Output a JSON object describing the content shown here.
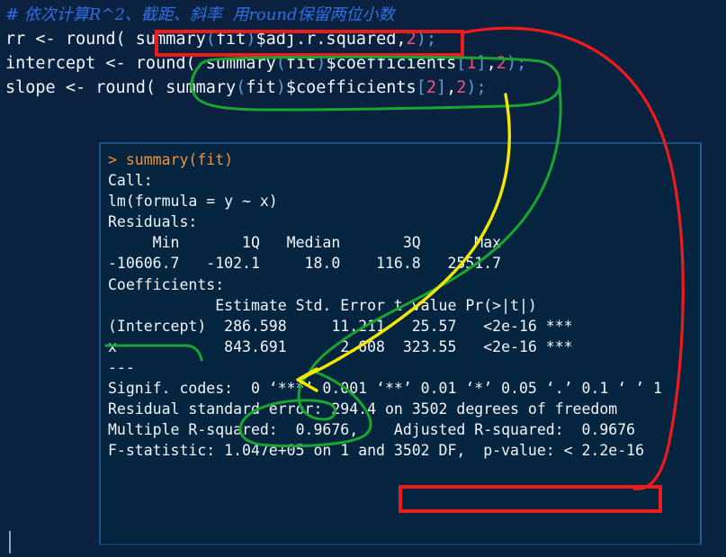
{
  "theme": {
    "editor_background": "#0a2240",
    "console_background": "#04243f",
    "console_border": "#1c4f86",
    "text": "#f2f6fa",
    "comment": "#2f6fe0",
    "prompt": "#f59331",
    "number": "#f0527f",
    "paren": "#5b9bd5",
    "annotation_red": "#ee1b1b",
    "annotation_green": "#1aa52e",
    "annotation_yellow": "#f5e800"
  },
  "editor": {
    "lines": [
      {
        "id": "comment-line",
        "tokens": [
          {
            "text": "# 依次计算R^2、截距、斜率  用round保留两位小数",
            "cls": "cmt"
          }
        ]
      },
      {
        "id": "line-rr",
        "tokens": [
          {
            "text": "rr <- round( summary",
            "cls": "ident"
          },
          {
            "text": "(",
            "cls": "paren"
          },
          {
            "text": "fit",
            "cls": "ident"
          },
          {
            "text": ")",
            "cls": "paren"
          },
          {
            "text": "$adj.r.squared",
            "cls": "ident"
          },
          {
            "text": ",",
            "cls": "punct"
          },
          {
            "text": "2",
            "cls": "num"
          },
          {
            "text": ")",
            "cls": "paren"
          },
          {
            "text": ";",
            "cls": "paren"
          }
        ]
      },
      {
        "id": "line-intercept",
        "tokens": [
          {
            "text": "intercept <- round( summary",
            "cls": "ident"
          },
          {
            "text": "(",
            "cls": "paren"
          },
          {
            "text": "fit",
            "cls": "ident"
          },
          {
            "text": ")",
            "cls": "paren"
          },
          {
            "text": "$coefficients",
            "cls": "ident"
          },
          {
            "text": "[",
            "cls": "paren"
          },
          {
            "text": "1",
            "cls": "num"
          },
          {
            "text": "]",
            "cls": "paren"
          },
          {
            "text": ",",
            "cls": "punct"
          },
          {
            "text": "2",
            "cls": "num"
          },
          {
            "text": ")",
            "cls": "paren"
          },
          {
            "text": ";",
            "cls": "paren"
          }
        ]
      },
      {
        "id": "line-slope",
        "tokens": [
          {
            "text": "slope <- round( summary",
            "cls": "ident"
          },
          {
            "text": "(",
            "cls": "paren"
          },
          {
            "text": "fit",
            "cls": "ident"
          },
          {
            "text": ")",
            "cls": "paren"
          },
          {
            "text": "$coefficients",
            "cls": "ident"
          },
          {
            "text": "[",
            "cls": "paren"
          },
          {
            "text": "2",
            "cls": "num"
          },
          {
            "text": "]",
            "cls": "paren"
          },
          {
            "text": ",",
            "cls": "punct"
          },
          {
            "text": "2",
            "cls": "num"
          },
          {
            "text": ")",
            "cls": "paren"
          },
          {
            "text": ";",
            "cls": "paren"
          }
        ]
      }
    ]
  },
  "console": {
    "lines": [
      {
        "text": "> summary(fit)",
        "kind": "prompt"
      },
      {
        "text": "",
        "kind": "blank"
      },
      {
        "text": "Call:",
        "kind": "out"
      },
      {
        "text": "lm(formula = y ~ x)",
        "kind": "out"
      },
      {
        "text": "",
        "kind": "blank"
      },
      {
        "text": "Residuals:",
        "kind": "out"
      },
      {
        "text": "     Min       1Q   Median       3Q      Max",
        "kind": "out"
      },
      {
        "text": "-10606.7   -102.1     18.0    116.8   2551.7",
        "kind": "out"
      },
      {
        "text": "",
        "kind": "blank"
      },
      {
        "text": "Coefficients:",
        "kind": "out"
      },
      {
        "text": "            Estimate Std. Error t value Pr(>|t|)",
        "kind": "out"
      },
      {
        "text": "(Intercept)  286.598     11.211   25.57   <2e-16 ***",
        "kind": "out"
      },
      {
        "text": "x            843.691      2.608  323.55   <2e-16 ***",
        "kind": "out"
      },
      {
        "text": "---",
        "kind": "out"
      },
      {
        "text": "Signif. codes:  0 ‘***’ 0.001 ‘**’ 0.01 ‘*’ 0.05 ‘.’ 0.1 ‘ ’ 1",
        "kind": "out"
      },
      {
        "text": "",
        "kind": "blank"
      },
      {
        "text": "Residual standard error: 294.4 on 3502 degrees of freedom",
        "kind": "out"
      },
      {
        "text": "Multiple R-squared:  0.9676,\tAdjusted R-squared:  0.9676",
        "kind": "out"
      },
      {
        "text": "F-statistic: 1.047e+05 on 1 and 3502 DF,  p-value: < 2.2e-16",
        "kind": "out"
      }
    ],
    "summary_values": {
      "call_formula": "lm(formula = y ~ x)",
      "residual_min": "-10606.7",
      "residual_1q": "-102.1",
      "residual_median": "18.0",
      "residual_3q": "116.8",
      "residual_max": "2551.7",
      "intercept_estimate": "286.598",
      "intercept_std_error": "11.211",
      "intercept_t_value": "25.57",
      "intercept_p_value": "<2e-16",
      "slope_estimate": "843.691",
      "slope_std_error": "2.608",
      "slope_t_value": "323.55",
      "slope_p_value": "<2e-16",
      "residual_standard_error": "294.4",
      "degrees_of_freedom": "3502",
      "multiple_r_squared": "0.9676",
      "adjusted_r_squared": "0.9676",
      "f_statistic": "1.047e+05",
      "p_value": "< 2.2e-16"
    }
  },
  "annotations": {
    "red_box_code_label": "summary(fit)$adj.r.squared",
    "red_box_output_label": "Adjusted R-squared:  0.9676",
    "red_link_description": "red curve connecting code expression to Adjusted R-squared output",
    "green_link_description": "green loop connecting summary(fit)$coefficients to the Estimate column",
    "yellow_arrow_description": "yellow arrow pointing to the slope estimate 843.691"
  }
}
